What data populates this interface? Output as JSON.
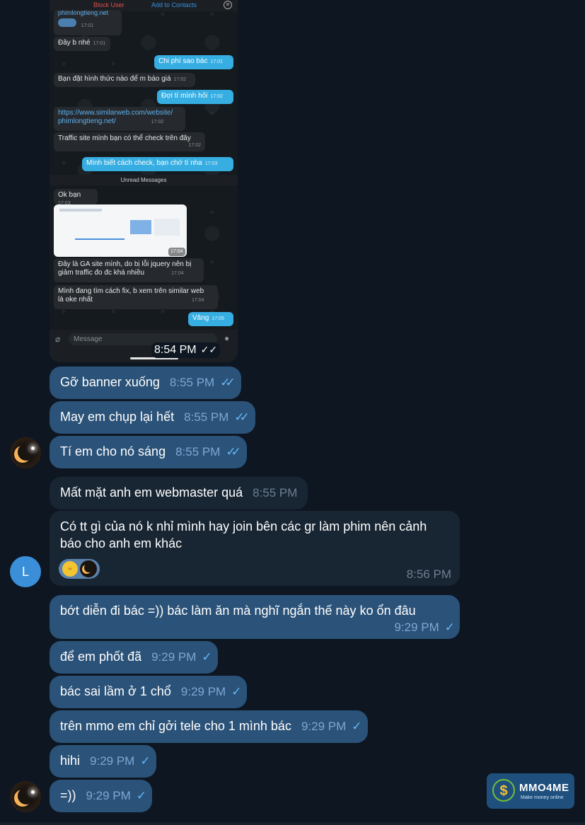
{
  "screenshot": {
    "topbar": {
      "block_user": "Block User",
      "add_contacts": "Add to Contacts",
      "site_name": "phimlongtieng.net",
      "site_time": "17:01"
    },
    "messages": [
      {
        "text": "Đây b nhé",
        "time": "17:01"
      },
      {
        "text": "Chi phí sao bác",
        "time": "17:01"
      },
      {
        "text": "Bạn đặt hình thức nào để m báo giá",
        "time": "17:02"
      },
      {
        "text": "Đợi tí mình hỏi",
        "time": "17:02"
      },
      {
        "text_line1": "https://www.similarweb.com/website/",
        "text_line2": "phimlongtieng.net/",
        "time": "17:02"
      },
      {
        "text": "Traffic site mình bạn có thể check trên đây",
        "time": "17:02"
      },
      {
        "text": "Mình biết cách check, bạn chờ tí nha",
        "time": "17:03"
      },
      {
        "text": "Ok bạn",
        "time": "17:03"
      },
      {
        "text": "",
        "time": "17:04"
      },
      {
        "text_line1": "Đây là GA site mình, do bị lỗi jquery nên bị",
        "text_line2": "giảm traffic đo đc khá nhiều",
        "time": "17:04"
      },
      {
        "text_line1": "Mình đang tìm cách fix, b xem trên similar web",
        "text_line2": "là oke nhất",
        "time": "17:04"
      },
      {
        "text": "Vâng",
        "time": "17:05"
      }
    ],
    "unread": "Unread Messages",
    "composer_placeholder": "Message",
    "sent_time": "8:54 PM"
  },
  "chat": [
    {
      "text": "Gỡ banner xuống",
      "time": "8:55 PM"
    },
    {
      "text": "May em chụp lại hết",
      "time": "8:55 PM"
    },
    {
      "text": "Tí em cho nó sáng",
      "time": "8:55 PM"
    },
    {
      "text": "Mất mặt anh em webmaster quá",
      "time": "8:55 PM"
    },
    {
      "text_line1": "Có tt gì của nó k nhỉ mình hay join bên các gr làm phim nên cảnh",
      "text_line2": "báo cho anh em khác",
      "time": "8:56 PM"
    },
    {
      "text": "bớt diễn đi bác =)) bác làm ăn mà nghĩ ngắn thế này ko ổn đâu",
      "time": "9:29 PM"
    },
    {
      "text": "để em phốt đã",
      "time": "9:29 PM"
    },
    {
      "text": "bác sai lầm ở 1 chổ",
      "time": "9:29 PM"
    },
    {
      "text": "trên mmo em chỉ gởi tele cho 1 mình bác",
      "time": "9:29 PM"
    },
    {
      "text": "hihi",
      "time": "9:29 PM"
    },
    {
      "text": "=))",
      "time": "9:29 PM"
    }
  ],
  "avatar_L": "L",
  "watermark": {
    "name": "MMO4ME",
    "tagline": "Make money online",
    "symbol": "$"
  },
  "icons": {
    "double_check": "✓✓",
    "single_check": "✓"
  },
  "colors": {
    "background": "#0e1621",
    "outgoing": "#2b5278",
    "incoming": "#182533",
    "check": "#64b6f7"
  }
}
